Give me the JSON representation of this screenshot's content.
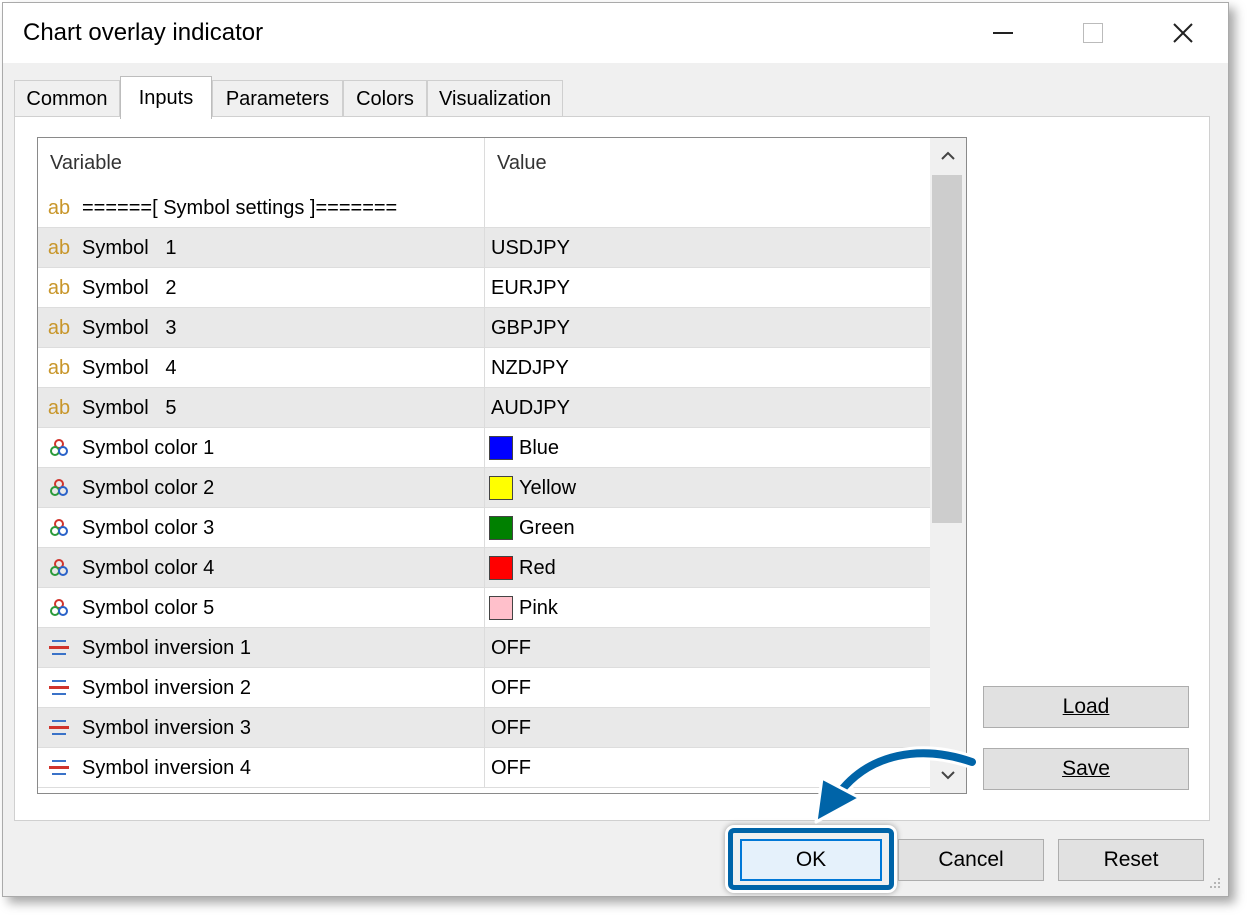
{
  "window": {
    "title": "Chart overlay indicator",
    "controls": [
      "minimize",
      "maximize",
      "close"
    ]
  },
  "tabs": [
    {
      "label": "Common",
      "active": false
    },
    {
      "label": "Inputs",
      "active": true
    },
    {
      "label": "Parameters",
      "active": false
    },
    {
      "label": "Colors",
      "active": false
    },
    {
      "label": "Visualization",
      "active": false
    }
  ],
  "grid": {
    "headers": {
      "variable": "Variable",
      "value": "Value"
    },
    "rows": [
      {
        "icon": "ab-icon",
        "variable": "======[ Symbol settings ]=======",
        "value": ""
      },
      {
        "icon": "ab-icon",
        "variable": "Symbol   1",
        "value": "USDJPY"
      },
      {
        "icon": "ab-icon",
        "variable": "Symbol   2",
        "value": "EURJPY"
      },
      {
        "icon": "ab-icon",
        "variable": "Symbol   3",
        "value": "GBPJPY"
      },
      {
        "icon": "ab-icon",
        "variable": "Symbol   4",
        "value": "NZDJPY"
      },
      {
        "icon": "ab-icon",
        "variable": "Symbol   5",
        "value": "AUDJPY"
      },
      {
        "icon": "color-palette-icon",
        "variable": "Symbol color 1",
        "value": "Blue",
        "swatch": "#0000ff"
      },
      {
        "icon": "color-palette-icon",
        "variable": "Symbol color 2",
        "value": "Yellow",
        "swatch": "#ffff00"
      },
      {
        "icon": "color-palette-icon",
        "variable": "Symbol color 3",
        "value": "Green",
        "swatch": "#008000"
      },
      {
        "icon": "color-palette-icon",
        "variable": "Symbol color 4",
        "value": "Red",
        "swatch": "#ff0000"
      },
      {
        "icon": "color-palette-icon",
        "variable": "Symbol color 5",
        "value": "Pink",
        "swatch": "#ffc0cb"
      },
      {
        "icon": "enum-list-icon",
        "variable": "Symbol inversion 1",
        "value": "OFF"
      },
      {
        "icon": "enum-list-icon",
        "variable": "Symbol inversion 2",
        "value": "OFF"
      },
      {
        "icon": "enum-list-icon",
        "variable": "Symbol inversion 3",
        "value": "OFF"
      },
      {
        "icon": "enum-list-icon",
        "variable": "Symbol inversion 4",
        "value": "OFF"
      }
    ]
  },
  "buttons": {
    "load": "Load",
    "save": "Save",
    "ok": "OK",
    "cancel": "Cancel",
    "reset": "Reset"
  },
  "colors": {
    "ab_icon": "#c8962a",
    "highlight": "#0064a8",
    "accent": "#0078d7"
  }
}
